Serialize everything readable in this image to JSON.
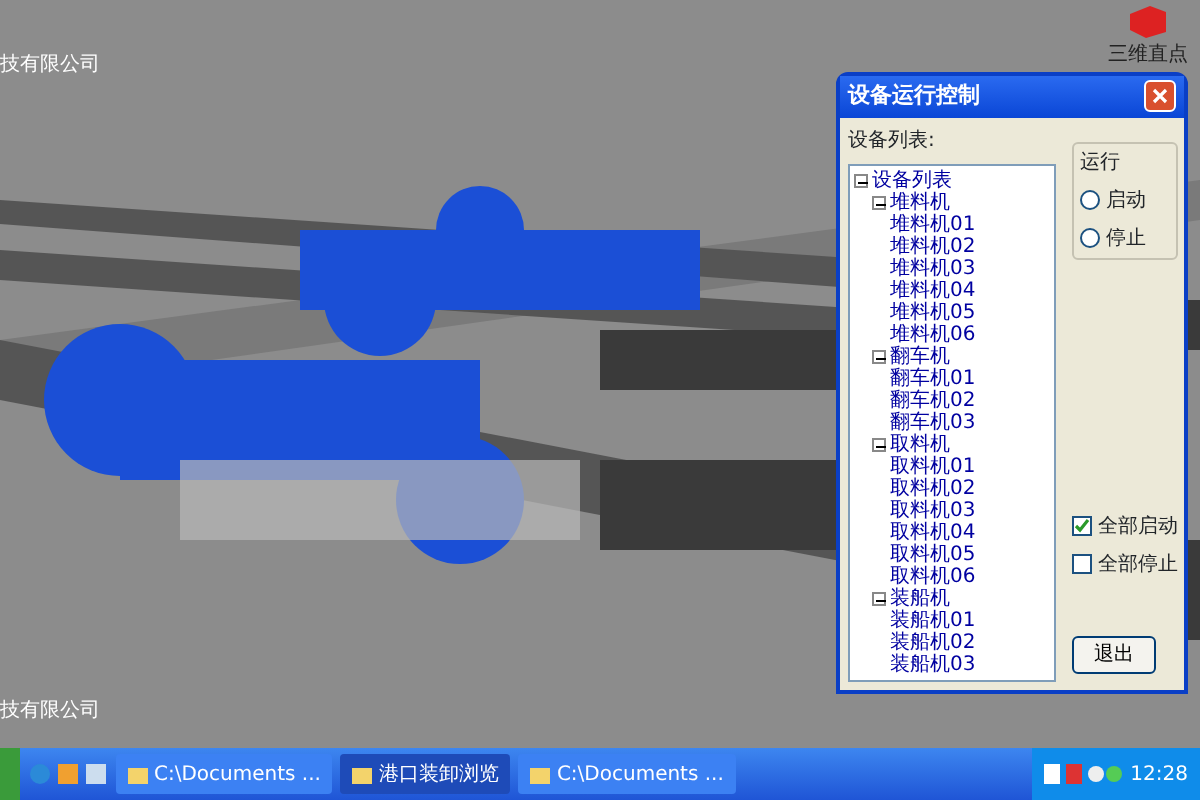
{
  "scene": {
    "caption_top": "技有限公司",
    "caption_bottom": "技有限公司",
    "logo_text": "三维直点"
  },
  "dialog": {
    "title": "设备运行控制",
    "tree_label": "设备列表:",
    "tree": [
      {
        "label": "设备列表",
        "expanded": true,
        "children": [
          {
            "label": "堆料机",
            "expanded": true,
            "children": [
              {
                "label": "堆料机01"
              },
              {
                "label": "堆料机02"
              },
              {
                "label": "堆料机03"
              },
              {
                "label": "堆料机04"
              },
              {
                "label": "堆料机05"
              },
              {
                "label": "堆料机06"
              }
            ]
          },
          {
            "label": "翻车机",
            "expanded": true,
            "children": [
              {
                "label": "翻车机01"
              },
              {
                "label": "翻车机02"
              },
              {
                "label": "翻车机03"
              }
            ]
          },
          {
            "label": "取料机",
            "expanded": true,
            "children": [
              {
                "label": "取料机01"
              },
              {
                "label": "取料机02"
              },
              {
                "label": "取料机03"
              },
              {
                "label": "取料机04"
              },
              {
                "label": "取料机05"
              },
              {
                "label": "取料机06"
              }
            ]
          },
          {
            "label": "装船机",
            "expanded": true,
            "children": [
              {
                "label": "装船机01"
              },
              {
                "label": "装船机02"
              },
              {
                "label": "装船机03"
              }
            ]
          }
        ]
      }
    ],
    "run_group": {
      "title": "运行",
      "options": [
        {
          "label": "启动",
          "selected": false
        },
        {
          "label": "停止",
          "selected": false
        }
      ]
    },
    "checks": [
      {
        "label": "全部启动",
        "checked": true
      },
      {
        "label": "全部停止",
        "checked": false
      }
    ],
    "exit_button": "退出"
  },
  "taskbar": {
    "tasks": [
      {
        "label": "C:\\Documents ...",
        "selected": false
      },
      {
        "label": "港口装卸浏览",
        "selected": true
      },
      {
        "label": "C:\\Documents ...",
        "selected": false
      }
    ],
    "clock": "12:28"
  }
}
